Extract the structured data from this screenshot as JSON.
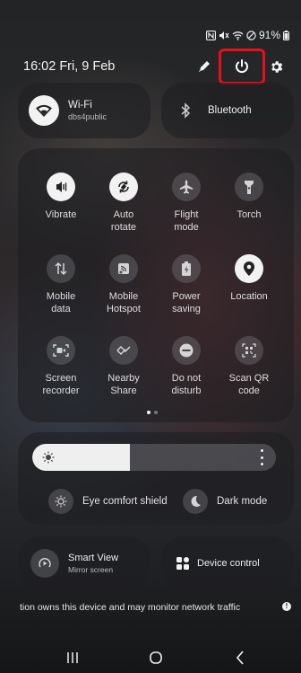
{
  "status_bar": {
    "battery_text": "91%"
  },
  "header": {
    "time": "16:02",
    "date": "Fri, 9 Feb"
  },
  "wifi": {
    "label": "Wi-Fi",
    "network": "dbs4public"
  },
  "bluetooth": {
    "label": "Bluetooth"
  },
  "quick_tiles": [
    {
      "label": "Vibrate",
      "state": "on",
      "icon": "vibrate-icon"
    },
    {
      "label": "Auto\nrotate",
      "state": "on",
      "icon": "auto-rotate-icon"
    },
    {
      "label": "Flight\nmode",
      "state": "off",
      "icon": "airplane-icon"
    },
    {
      "label": "Torch",
      "state": "off",
      "icon": "torch-icon"
    },
    {
      "label": "Mobile\ndata",
      "state": "off",
      "icon": "mobile-data-icon"
    },
    {
      "label": "Mobile\nHotspot",
      "state": "off",
      "icon": "hotspot-icon"
    },
    {
      "label": "Power\nsaving",
      "state": "off",
      "icon": "battery-icon"
    },
    {
      "label": "Location",
      "state": "on",
      "icon": "location-icon"
    },
    {
      "label": "Screen\nrecorder",
      "state": "off",
      "icon": "screen-recorder-icon"
    },
    {
      "label": "Nearby\nShare",
      "state": "off",
      "icon": "nearby-share-icon"
    },
    {
      "label": "Do not\ndisturb",
      "state": "off",
      "icon": "do-not-disturb-icon"
    },
    {
      "label": "Scan QR\ncode",
      "state": "off",
      "icon": "qr-code-icon"
    }
  ],
  "pager": {
    "pages": 2,
    "current": 1
  },
  "brightness": {
    "level": 0.4
  },
  "eye_comfort": {
    "label": "Eye comfort shield"
  },
  "dark_mode": {
    "label": "Dark mode"
  },
  "smart_view": {
    "label": "Smart View",
    "sub": "Mirror screen"
  },
  "device_control": {
    "label": "Device control"
  },
  "notice": {
    "text": "tion owns this device and may monitor network traffic"
  },
  "colors": {
    "highlight": "#e8101a",
    "tile_on": "#f2f2f2"
  }
}
